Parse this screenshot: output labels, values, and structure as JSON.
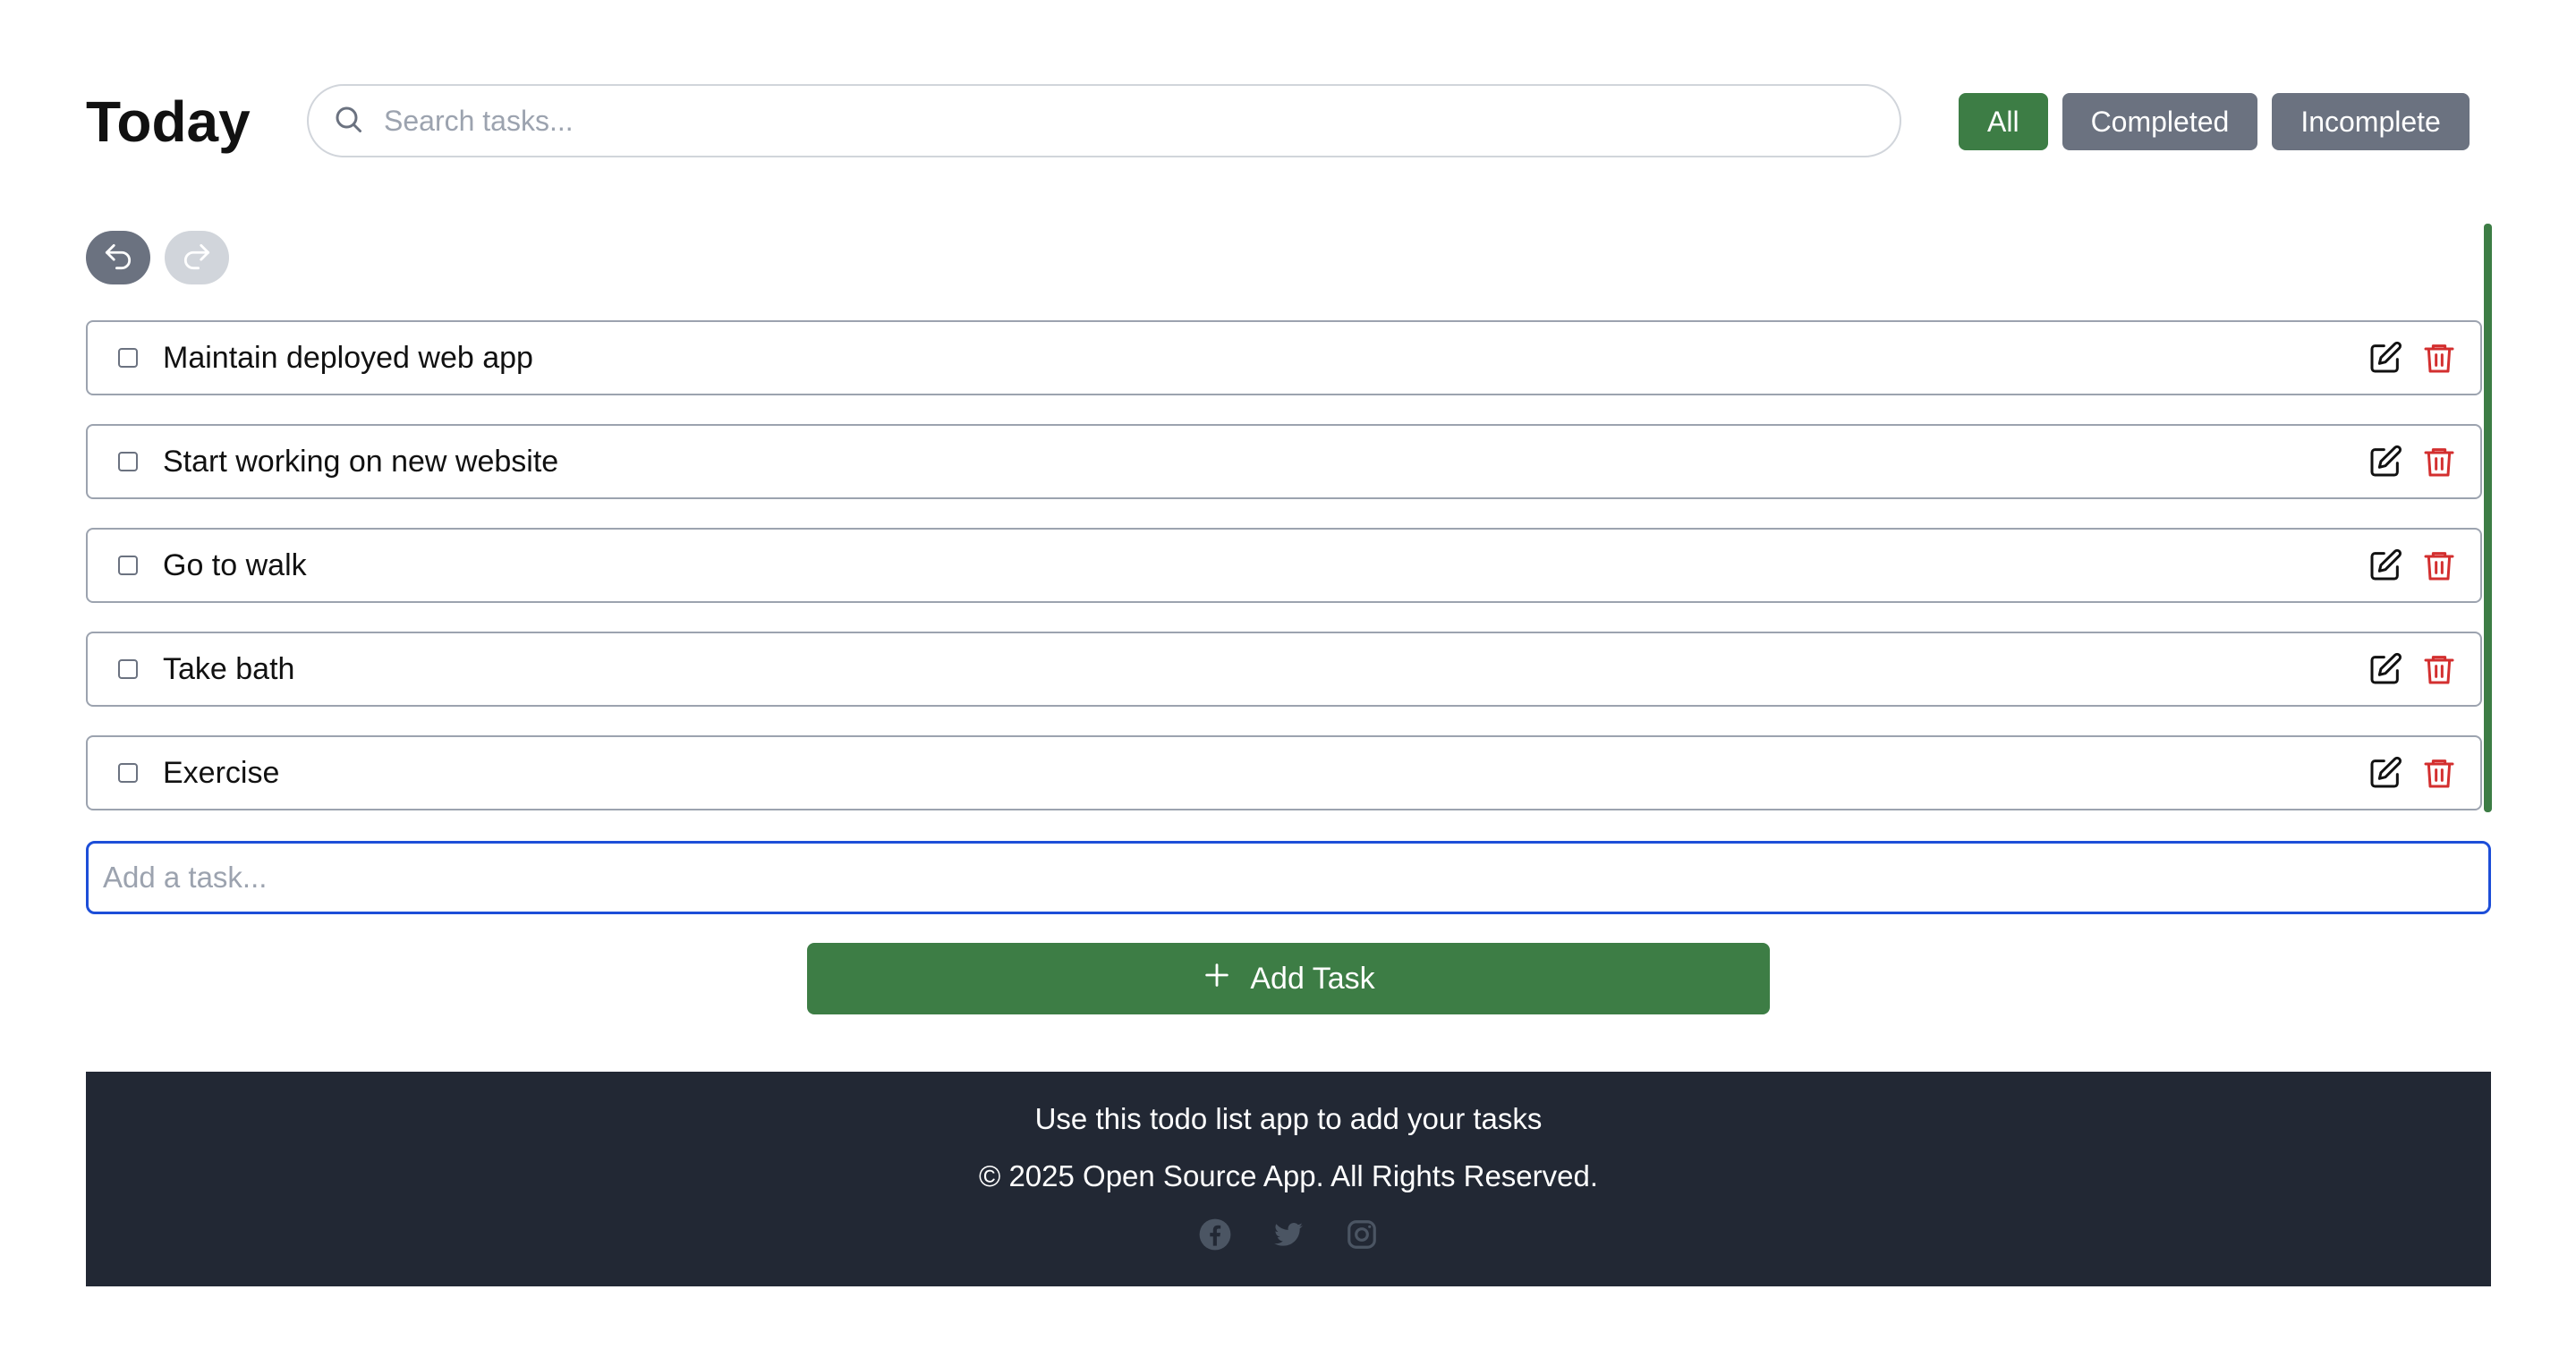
{
  "header": {
    "title": "Today",
    "search_placeholder": "Search tasks...",
    "filters": [
      {
        "label": "All",
        "active": true
      },
      {
        "label": "Completed",
        "active": false
      },
      {
        "label": "Incomplete",
        "active": false
      }
    ]
  },
  "history": {
    "undo_icon": "undo-icon",
    "redo_icon": "redo-icon",
    "redo_enabled": false
  },
  "tasks": [
    {
      "label": "Maintain deployed web app",
      "done": false
    },
    {
      "label": "Start working on new website",
      "done": false
    },
    {
      "label": "Go to walk",
      "done": false
    },
    {
      "label": "Take bath",
      "done": false
    },
    {
      "label": "Exercise",
      "done": false
    }
  ],
  "add_task": {
    "placeholder": "Add a task...",
    "button_label": "Add Task"
  },
  "footer": {
    "tagline": "Use this todo list app to add your tasks",
    "copyright": "© 2025 Open Source App. All Rights Reserved.",
    "social": [
      "facebook-icon",
      "twitter-icon",
      "instagram-icon"
    ]
  },
  "colors": {
    "accent": "#3d7d45",
    "inactive_button": "#6b7280",
    "danger": "#d32f2f",
    "footer_bg": "#222834",
    "focus_border": "#1d4ed8"
  }
}
